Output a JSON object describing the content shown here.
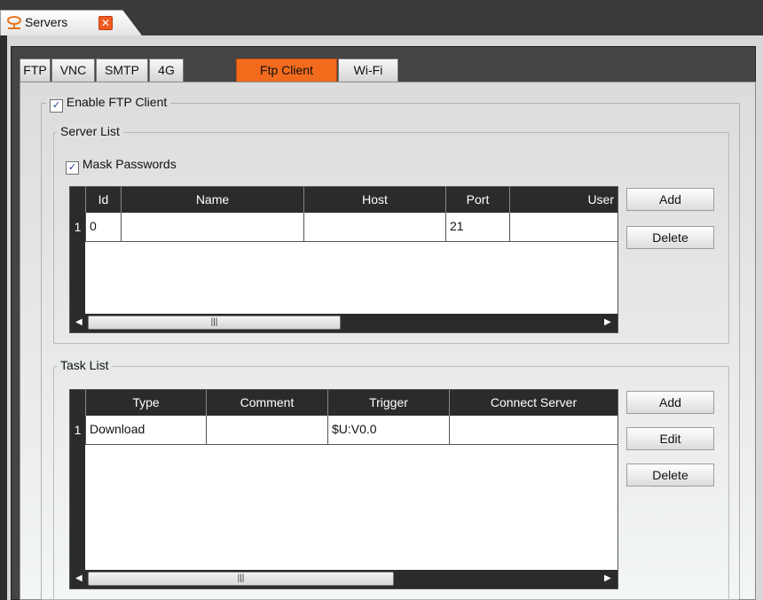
{
  "window": {
    "tab_title": "Servers",
    "tab_icon": "server-network-icon",
    "close_icon": "close-icon"
  },
  "tabs": [
    {
      "label": "FTP"
    },
    {
      "label": "VNC"
    },
    {
      "label": "SMTP"
    },
    {
      "label": "4G"
    },
    {
      "label": "Ftp Client",
      "active": true
    },
    {
      "label": "Wi-Fi"
    }
  ],
  "enable_ftp_client": {
    "label": "Enable FTP Client",
    "checked": true
  },
  "server_list": {
    "title": "Server List",
    "mask_passwords": {
      "label": "Mask Passwords",
      "checked": true
    },
    "columns": [
      "Id",
      "Name",
      "Host",
      "Port",
      "User"
    ],
    "rows": [
      {
        "num": "1",
        "id": "0",
        "name": "",
        "host": "",
        "port": "21",
        "user": ""
      }
    ],
    "buttons": {
      "add": "Add",
      "delete": "Delete"
    }
  },
  "task_list": {
    "title": "Task List",
    "columns": [
      "Type",
      "Comment",
      "Trigger",
      "Connect Server"
    ],
    "rows": [
      {
        "num": "1",
        "type": "Download",
        "comment": "",
        "trigger": "$U:V0.0",
        "connect_server": ""
      }
    ],
    "buttons": {
      "add": "Add",
      "edit": "Edit",
      "delete": "Delete"
    }
  },
  "colors": {
    "active_tab": "#f26b1d",
    "grid_header": "#2b2b2b",
    "close_button": "#f05a22"
  }
}
